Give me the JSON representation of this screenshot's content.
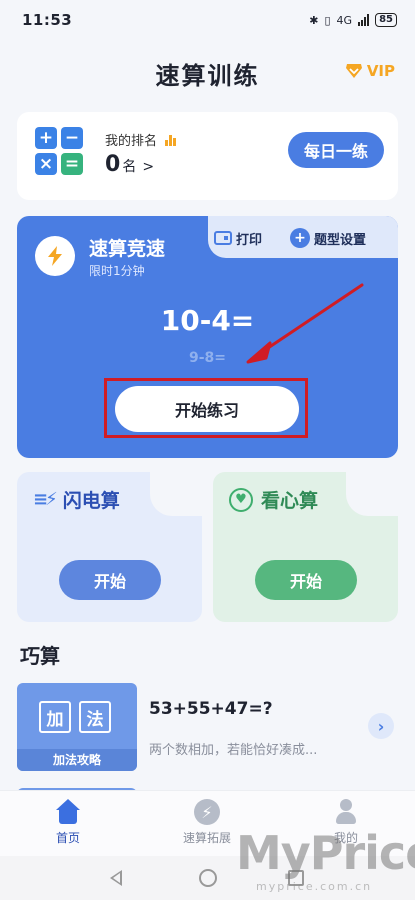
{
  "status_bar": {
    "time": "11:53",
    "network": "4G",
    "battery": "85"
  },
  "header": {
    "title": "速算训练",
    "vip_label": "VIP"
  },
  "rank": {
    "label": "我的排名",
    "value": "0",
    "unit": "名",
    "daily_button": "每日一练"
  },
  "race": {
    "title": "速算竞速",
    "subtitle": "限时1分钟",
    "print_label": "打印",
    "settings_label": "题型设置",
    "question": "10-4=",
    "next_question": "9-8=",
    "start_label": "开始练习"
  },
  "modes": [
    {
      "title": "闪电算",
      "button": "开始"
    },
    {
      "title": "看心算",
      "button": "开始"
    }
  ],
  "tricks": {
    "section_title": "巧算",
    "items": [
      {
        "thumb_chars": [
          "加",
          "法"
        ],
        "thumb_label": "加法攻略",
        "equation": "53+55+47=?",
        "description": "两个数相加，若能恰好凑成..."
      }
    ]
  },
  "bottom_nav": [
    {
      "label": "首页",
      "icon": "home-icon",
      "active": true
    },
    {
      "label": "速算拓展",
      "icon": "expand-icon",
      "active": false
    },
    {
      "label": "我的",
      "icon": "profile-icon",
      "active": false
    }
  ],
  "watermark": {
    "main": "MyPrice",
    "sub": "myprice.com.cn"
  },
  "colors": {
    "primary": "#4a7de2",
    "green": "#56b77f",
    "vip": "#f5a623",
    "annotation": "#d01c24"
  }
}
